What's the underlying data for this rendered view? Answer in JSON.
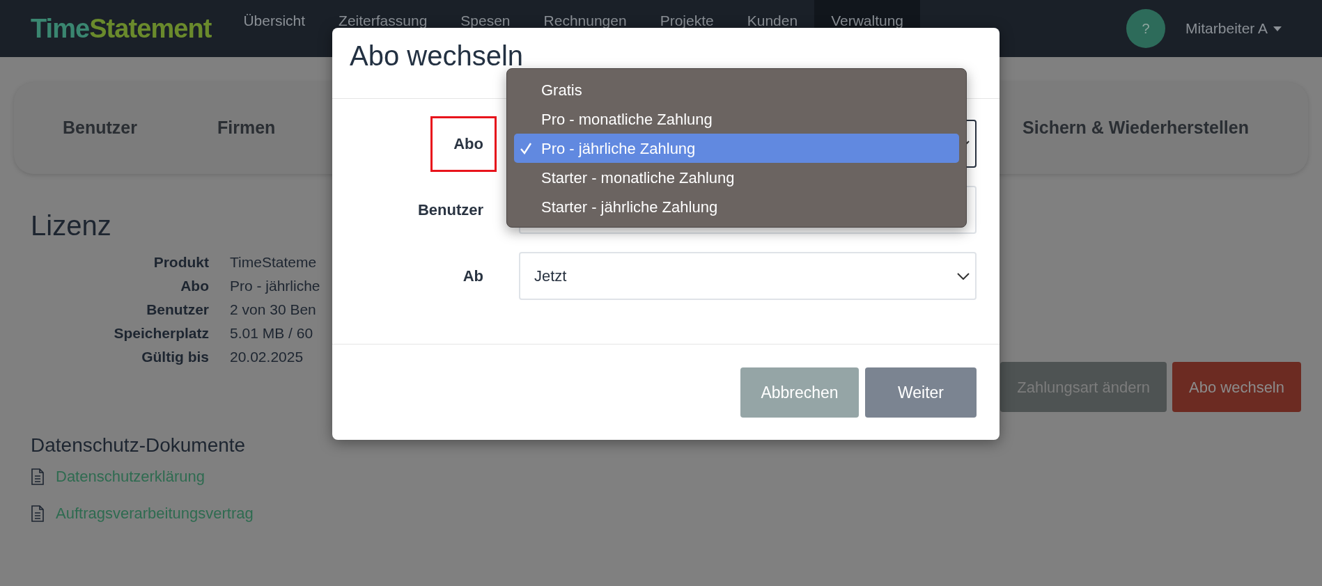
{
  "navbar": {
    "logo": [
      "Time",
      "Statement"
    ],
    "items": [
      {
        "label": "Übersicht",
        "selected": false
      },
      {
        "label": "Zeiterfassung",
        "selected": false
      },
      {
        "label": "Spesen",
        "selected": false
      },
      {
        "label": "Rechnungen",
        "selected": false
      },
      {
        "label": "Projekte",
        "selected": false
      },
      {
        "label": "Kunden",
        "selected": false
      },
      {
        "label": "Verwaltung",
        "selected": true
      }
    ],
    "help": "?",
    "user_menu": "Mitarbeiter A"
  },
  "admin_tabs": [
    {
      "label": "Benutzer"
    },
    {
      "label": "Firmen"
    },
    {
      "label": "Sichern & Wiederherstellen"
    }
  ],
  "license": {
    "title": "Lizenz",
    "rows": [
      {
        "label": "Produkt",
        "value": "TimeStateme"
      },
      {
        "label": "Abo",
        "value": "Pro - jährliche"
      },
      {
        "label": "Benutzer",
        "value": "2 von 30 Ben"
      },
      {
        "label": "Speicherplatz",
        "value": "5.01 MB / 60"
      },
      {
        "label": "Gültig bis",
        "value": "20.02.2025"
      }
    ],
    "buttons": [
      {
        "label": "Zahlungsart ändern",
        "kind": "secondary"
      },
      {
        "label": "Abo wechseln",
        "kind": "danger"
      }
    ]
  },
  "privacy": {
    "title": "Datenschutz-Dokumente",
    "links": [
      "Datenschutzerklärung",
      "Auftragsverarbeitungsvertrag"
    ]
  },
  "modal": {
    "title": "Abo wechseln",
    "fields": [
      {
        "label": "Abo",
        "kind": "select",
        "annotated": true
      },
      {
        "label": "Benutzer",
        "kind": "input",
        "annotated": false
      },
      {
        "label": "Ab",
        "kind": "select",
        "value": "Jetzt",
        "annotated": false
      }
    ],
    "dropdown": [
      {
        "label": "Gratis",
        "selected": false
      },
      {
        "label": "Pro - monatliche Zahlung",
        "selected": false
      },
      {
        "label": "Pro - jährliche Zahlung",
        "selected": true
      },
      {
        "label": "Starter - monatliche Zahlung",
        "selected": false
      },
      {
        "label": "Starter - jährliche Zahlung",
        "selected": false
      }
    ],
    "buttons": [
      {
        "label": "Abbrechen",
        "kind": "secondary"
      },
      {
        "label": "Weiter",
        "kind": "primary"
      }
    ]
  }
}
